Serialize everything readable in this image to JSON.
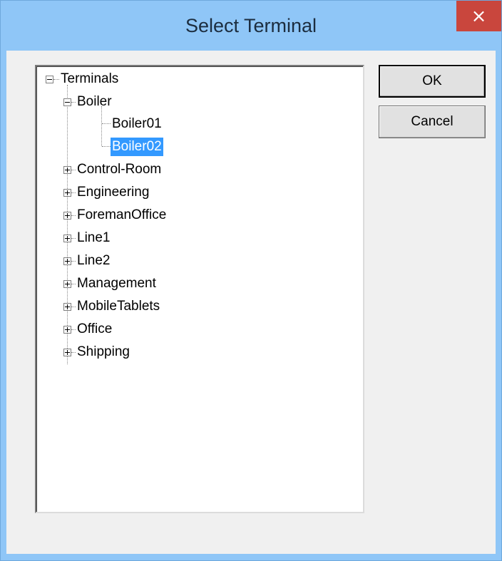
{
  "window": {
    "title": "Select Terminal",
    "close_symbol": "×"
  },
  "tree": {
    "root": {
      "label": "Terminals",
      "expanded": true,
      "children": [
        {
          "label": "Boiler",
          "expanded": true,
          "children": [
            {
              "label": "Boiler01",
              "selected": false
            },
            {
              "label": "Boiler02",
              "selected": true
            }
          ]
        },
        {
          "label": "Control-Room",
          "expanded": false
        },
        {
          "label": "Engineering",
          "expanded": false
        },
        {
          "label": "ForemanOffice",
          "expanded": false
        },
        {
          "label": "Line1",
          "expanded": false
        },
        {
          "label": "Line2",
          "expanded": false
        },
        {
          "label": "Management",
          "expanded": false
        },
        {
          "label": "MobileTablets",
          "expanded": false
        },
        {
          "label": "Office",
          "expanded": false
        },
        {
          "label": "Shipping",
          "expanded": false
        }
      ]
    }
  },
  "buttons": {
    "ok_label": "OK",
    "cancel_label": "Cancel"
  },
  "colors": {
    "titlebar": "#8fc6f7",
    "close_button": "#c9463d",
    "selection": "#3399ff"
  }
}
